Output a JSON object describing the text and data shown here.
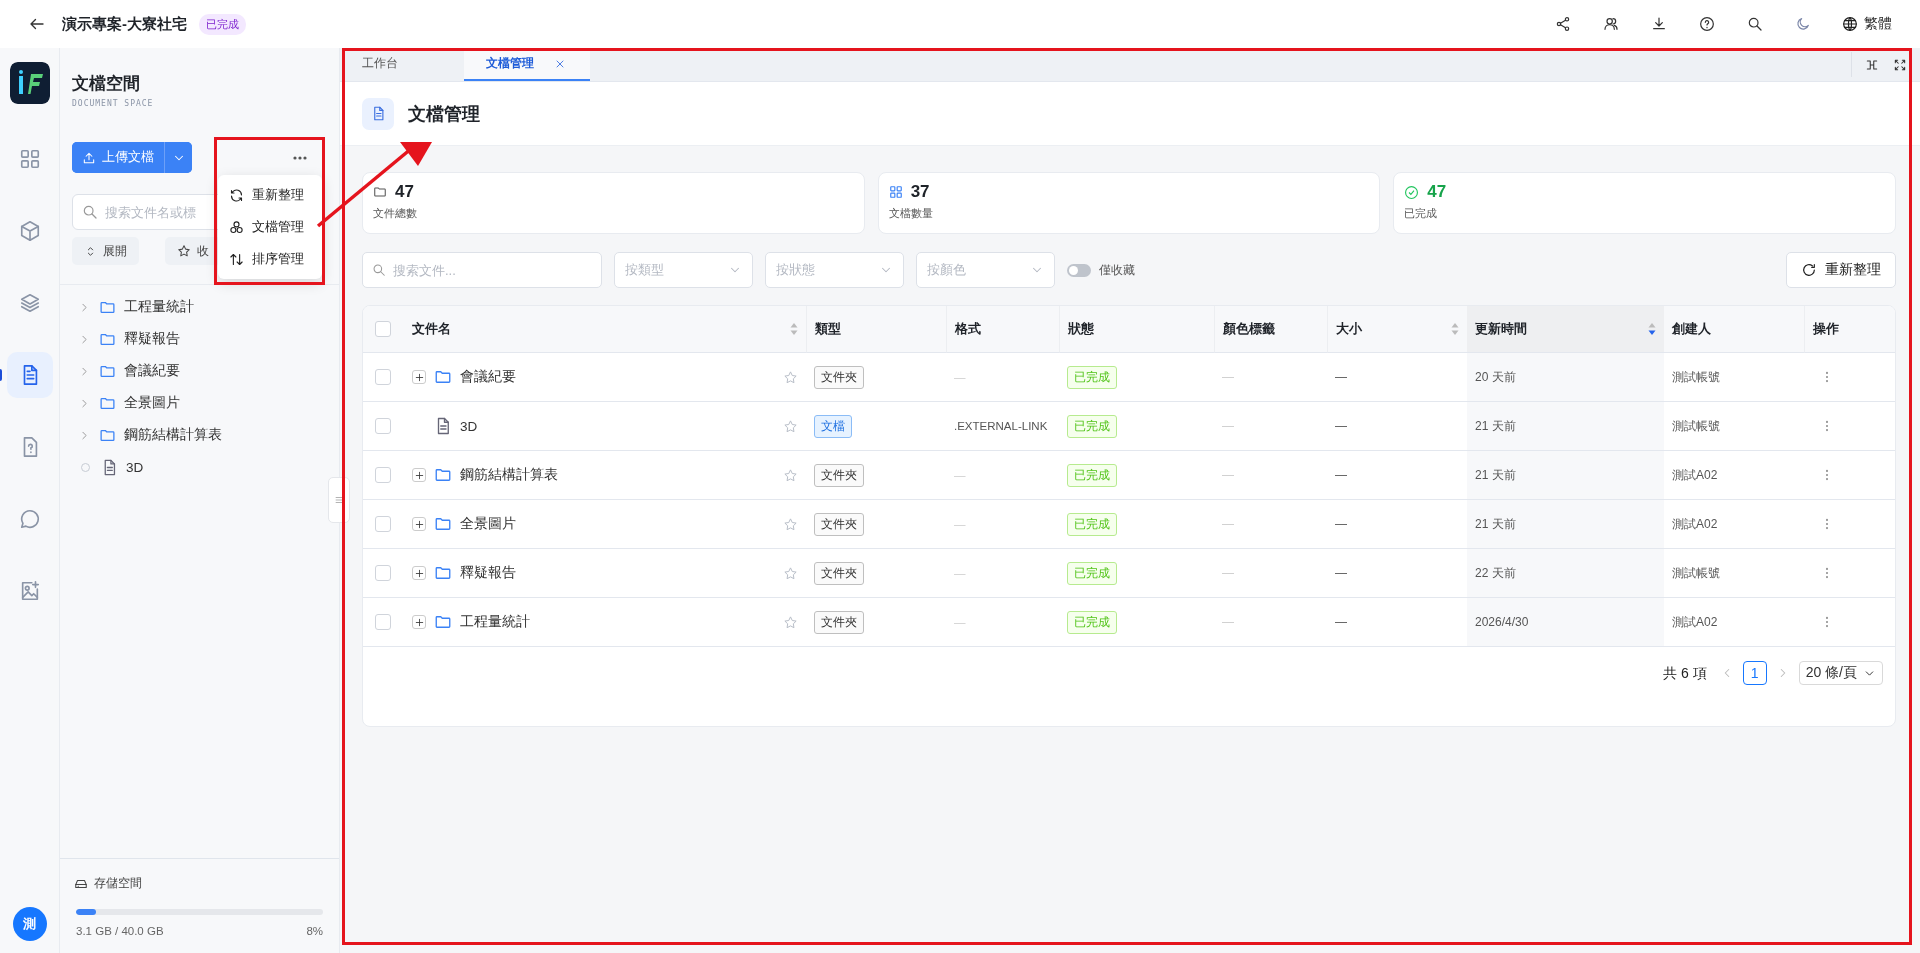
{
  "top_bar": {
    "title": "演示專案-大寮社宅",
    "status_badge": "已完成",
    "language": "繁體"
  },
  "rail": {
    "items": [
      {
        "selected": false
      },
      {
        "selected": false
      },
      {
        "selected": false
      },
      {
        "selected": true
      },
      {
        "selected": false
      },
      {
        "selected": false
      },
      {
        "selected": false
      }
    ],
    "avatar": "測"
  },
  "sidebar": {
    "title": "文檔空間",
    "subtitle": "DOCUMENT SPACE",
    "upload_button": "上傳文檔",
    "search": {
      "placeholder": "搜索文件名或標"
    },
    "expand_button": "展開",
    "favorites_button": "收",
    "tree": [
      {
        "kind": "folder",
        "label": "工程量統計"
      },
      {
        "kind": "folder",
        "label": "釋疑報告"
      },
      {
        "kind": "folder",
        "label": "會議紀要"
      },
      {
        "kind": "folder",
        "label": "全景圖片"
      },
      {
        "kind": "folder",
        "label": "鋼筋結構計算表"
      },
      {
        "kind": "file",
        "label": "3D"
      }
    ],
    "storage": {
      "label": "存儲空間",
      "level": 0.08,
      "used": "3.1 GB / 40.0 GB",
      "percent": "8%"
    }
  },
  "menu": {
    "items": [
      {
        "kind": "refresh",
        "label": "重新整理"
      },
      {
        "kind": "manage",
        "label": "文檔管理"
      },
      {
        "kind": "sort",
        "label": "排序管理"
      }
    ]
  },
  "tabs": [
    {
      "label": "工作台",
      "selected": false,
      "closable": false
    },
    {
      "label": "文檔管理",
      "selected": true,
      "closable": true
    }
  ],
  "page_title": "文檔管理",
  "stats": [
    {
      "kind": "files",
      "value": "47",
      "label": "文件總數"
    },
    {
      "kind": "documents",
      "value": "37",
      "label": "文檔數量"
    },
    {
      "kind": "done",
      "value": "47",
      "label": "已完成"
    }
  ],
  "filters": {
    "search": {
      "placeholder": "搜索文件..."
    },
    "selects": [
      {
        "placeholder": "按類型"
      },
      {
        "placeholder": "按狀態"
      },
      {
        "placeholder": "按顏色"
      }
    ],
    "favorites_only": {
      "label": "僅收藏",
      "on": false
    },
    "refresh_button": "重新整理"
  },
  "table": {
    "header_checked": false,
    "columns": [
      {
        "label": "文件名",
        "sortable": true,
        "sorted": false
      },
      {
        "label": "類型"
      },
      {
        "label": "格式"
      },
      {
        "label": "狀態"
      },
      {
        "label": "顏色標籤"
      },
      {
        "label": "大小",
        "sortable": true,
        "sorted": false
      },
      {
        "label": "更新時間",
        "sortable": true,
        "sorted": true
      },
      {
        "label": "創建人"
      },
      {
        "label": "操作"
      }
    ],
    "rows": [
      {
        "checked": false,
        "kind": "folder",
        "name": "會議紀要",
        "favorite": false,
        "type": "文件夾",
        "format": "—",
        "status": "已完成",
        "color_tag": "—",
        "size": "—",
        "updated": "20 天前",
        "creator": "測試帳號"
      },
      {
        "checked": false,
        "kind": "file",
        "name": "3D",
        "favorite": false,
        "type": "文檔",
        "format": ".EXTERNAL-LINK",
        "status": "已完成",
        "color_tag": "—",
        "size": "—",
        "updated": "21 天前",
        "creator": "測試帳號"
      },
      {
        "checked": false,
        "kind": "folder",
        "name": "鋼筋結構計算表",
        "favorite": false,
        "type": "文件夾",
        "format": "—",
        "status": "已完成",
        "color_tag": "—",
        "size": "—",
        "updated": "21 天前",
        "creator": "測試A02"
      },
      {
        "checked": false,
        "kind": "folder",
        "name": "全景圖片",
        "favorite": false,
        "type": "文件夾",
        "format": "—",
        "status": "已完成",
        "color_tag": "—",
        "size": "—",
        "updated": "21 天前",
        "creator": "測試A02"
      },
      {
        "checked": false,
        "kind": "folder",
        "name": "釋疑報告",
        "favorite": false,
        "type": "文件夾",
        "format": "—",
        "status": "已完成",
        "color_tag": "—",
        "size": "—",
        "updated": "22 天前",
        "creator": "測試帳號"
      },
      {
        "checked": false,
        "kind": "folder",
        "name": "工程量統計",
        "favorite": false,
        "type": "文件夾",
        "format": "—",
        "status": "已完成",
        "color_tag": "—",
        "size": "—",
        "updated": "2026/4/30",
        "creator": "測試A02"
      }
    ]
  },
  "pagination": {
    "total": "共 6 項",
    "pages": [
      {
        "label": "1",
        "selected": true
      }
    ],
    "page_size": "20 條/頁"
  },
  "annotations": [
    {
      "kind": "box"
    },
    {
      "kind": "box"
    },
    {
      "kind": "arrow"
    }
  ]
}
